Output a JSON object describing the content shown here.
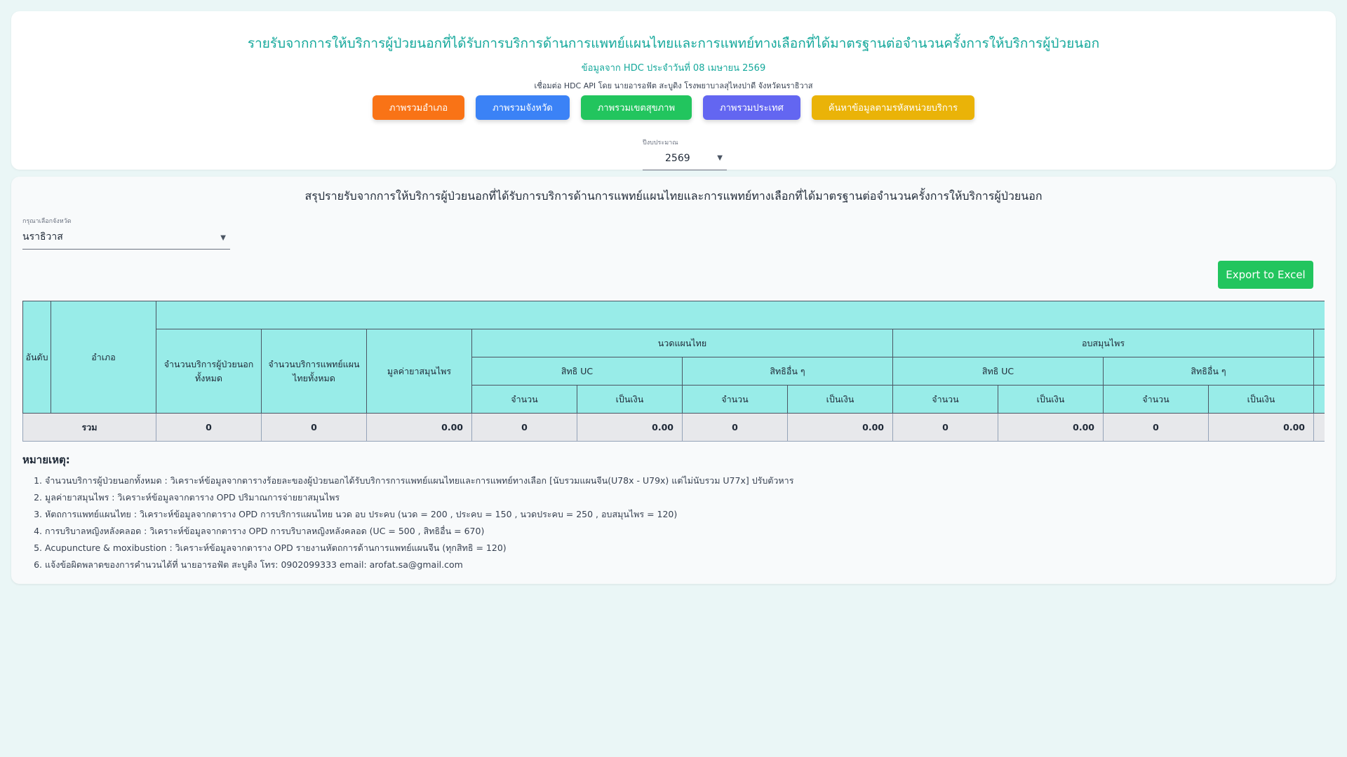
{
  "header": {
    "title": "รายรับจากการให้บริการผู้ป่วยนอกที่ได้รับการบริการด้านการแพทย์แผนไทยและการแพทย์ทางเลือกที่ได้มาตรฐานต่อจำนวนครั้งการให้บริการผู้ป่วยนอก",
    "subtitle": "ข้อมูลจาก HDC ประจำวันที่ 08 เมษายน 2569",
    "credit": "เชื่อมต่อ HDC API โดย นายอารอฟัต สะบูดิง โรงพยาบาลสุไหงปาดี จังหวัดนราธิวาส"
  },
  "nav": [
    {
      "label": "ภาพรวมอำเภอ",
      "color": "#f97316"
    },
    {
      "label": "ภาพรวมจังหวัด",
      "color": "#3b82f6"
    },
    {
      "label": "ภาพรวมเขตสุขภาพ",
      "color": "#22c55e"
    },
    {
      "label": "ภาพรวมประเทศ",
      "color": "#6366f1"
    },
    {
      "label": "ค้นหาข้อมูลตามรหัสหน่วยบริการ",
      "color": "#eab308"
    }
  ],
  "year": {
    "label": "ปีงบประมาณ",
    "value": "2569"
  },
  "summary": {
    "title": "สรุปรายรับจากการให้บริการผู้ป่วยนอกที่ได้รับการบริการด้านการแพทย์แผนไทยและการแพทย์ทางเลือกที่ได้มาตรฐานต่อจำนวนครั้งการให้บริการผู้ป่วยนอก",
    "province_label": "กรุณาเลือกจังหวัด",
    "province_value": "นราธิวาส",
    "export_label": "Export to Excel"
  },
  "table": {
    "h_rank": "อันดับ",
    "h_amphoe": "อำเภอ",
    "h_opd": "จำนวนบริการผู้ป่วยนอกทั้งหมด",
    "h_ttm": "จำนวนบริการแพทย์แผนไทยทั้งหมด",
    "h_herb": "มูลค่ายาสมุนไพร",
    "g1": "นวดแผนไทย",
    "g2": "อบสมุนไพร",
    "uc": "สิทธิ UC",
    "other": "สิทธิอื่น ๆ",
    "count": "จำนวน",
    "money": "เป็นเงิน",
    "total": {
      "label": "รวม",
      "opd": "0",
      "ttm": "0",
      "herb": "0.00",
      "g1_uc_n": "0",
      "g1_uc_m": "0.00",
      "g1_o_n": "0",
      "g1_o_m": "0.00",
      "g2_uc_n": "0",
      "g2_uc_m": "0.00",
      "g2_o_n": "0",
      "g2_o_m": "0.00"
    }
  },
  "notes": {
    "heading": "หมายเหตุ:",
    "items": [
      "จำนวนบริการผู้ป่วยนอกทั้งหมด : วิเคราะห์ข้อมูลจากตารางร้อยละของผู้ป่วยนอกได้รับบริการการแพทย์แผนไทยและการแพทย์ทางเลือก [นับรวมแผนจีน(U78x - U79x) แต่ไม่นับรวม U77x] ปรับตัวหาร",
      "มูลค่ายาสมุนไพร : วิเคราะห์ข้อมูลจากตาราง OPD ปริมาณการจ่ายยาสมุนไพร",
      "หัตถการแพทย์แผนไทย : วิเคราะห์ข้อมูลจากตาราง OPD การบริการแผนไทย นวด อบ ประคบ (นวด = 200 , ประคบ = 150 , นวดประคบ = 250 , อบสมุนไพร = 120)",
      "การบริบาลหญิงหลังคลอด : วิเคราะห์ข้อมูลจากตาราง OPD การบริบาลหญิงหลังคลอด (UC = 500 , สิทธิอื่น = 670)",
      "Acupuncture & moxibustion : วิเคราะห์ข้อมูลจากตาราง OPD รายงานหัตถการด้านการแพทย์แผนจีน (ทุกสิทธิ = 120)",
      "แจ้งข้อผิดพลาดของการคำนวนได้ที่ นายอารอฟัต สะบูดิง โทร: 0902099333 email: arofat.sa@gmail.com"
    ]
  }
}
